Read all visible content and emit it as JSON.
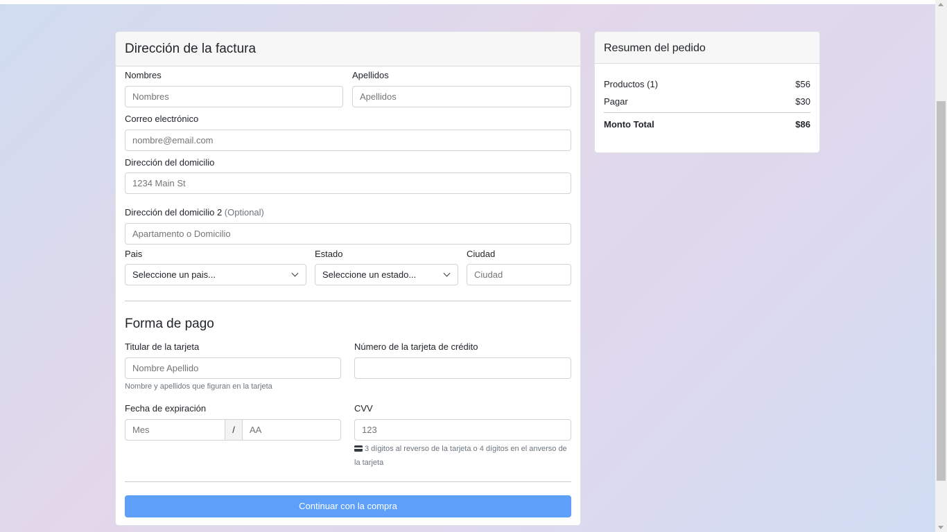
{
  "billing": {
    "title": "Dirección de la factura",
    "first_name": {
      "label": "Nombres",
      "placeholder": "Nombres"
    },
    "last_name": {
      "label": "Apellidos",
      "placeholder": "Apellidos"
    },
    "email": {
      "label": "Correo electrónico",
      "placeholder": "nombre@email.com"
    },
    "address": {
      "label": "Dirección del domicilio",
      "placeholder": "1234 Main St"
    },
    "address2": {
      "label": "Dirección del domicilio 2",
      "optional": "(Optional)",
      "placeholder": "Apartamento o Domicilio"
    },
    "country": {
      "label": "Pais",
      "value": "Seleccione un pais..."
    },
    "state": {
      "label": "Estado",
      "value": "Seleccione un estado..."
    },
    "city": {
      "label": "Ciudad",
      "placeholder": "Ciudad"
    }
  },
  "payment": {
    "title": "Forma de pago",
    "holder": {
      "label": "Titular de la tarjeta",
      "placeholder": "Nombre Apellido",
      "help": "Nombre y apellidos que figuran en la tarjeta"
    },
    "number": {
      "label": "Número de la tarjeta de crédito",
      "placeholder": ""
    },
    "expiry": {
      "label": "Fecha de expiración",
      "month_placeholder": "Mes",
      "separator": "/",
      "year_placeholder": "AA"
    },
    "cvv": {
      "label": "CVV",
      "placeholder": "123",
      "help": "3 dígitos al reverso de la tarjeta o 4 dígitos en el anverso de la tarjeta",
      "icon": "credit-card-icon"
    },
    "submit_label": "Continuar con la compra"
  },
  "summary": {
    "title": "Resumen del pedido",
    "rows": [
      {
        "label": "Productos (1)",
        "value": "$56"
      },
      {
        "label": "Pagar",
        "value": "$30"
      }
    ],
    "total": {
      "label": "Monto Total",
      "value": "$86"
    }
  },
  "colors": {
    "primary_button": "#5ea0f9",
    "header_bg": "#f7f7f7"
  }
}
